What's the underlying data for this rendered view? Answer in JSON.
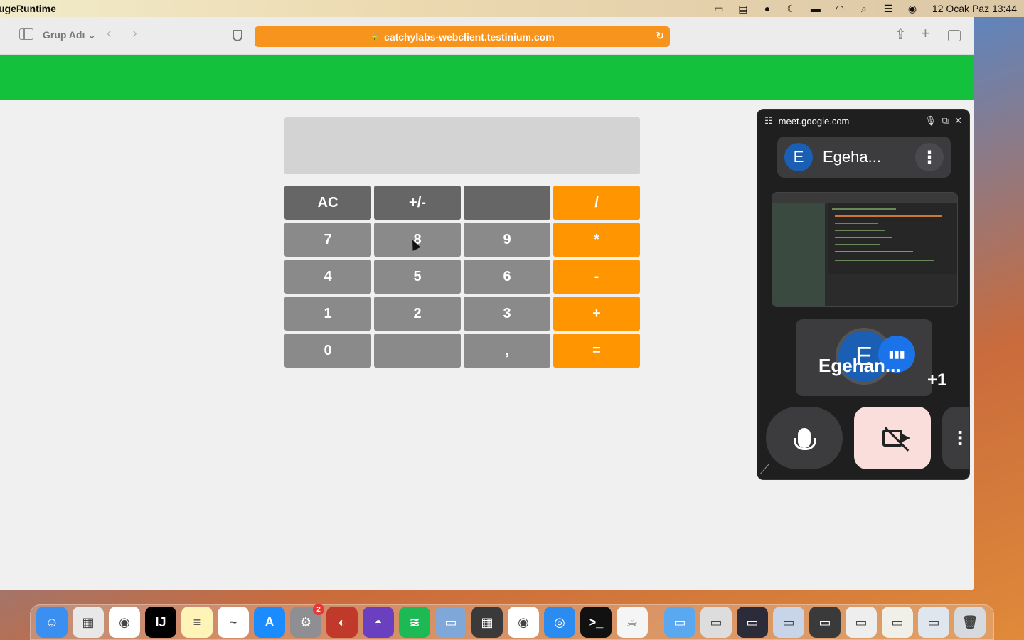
{
  "menubar": {
    "app_name": "ugeRuntime",
    "clock": "12 Ocak Paz  13:44",
    "icons": [
      "screen-mirror-icon",
      "vpn-icon",
      "globe-icon",
      "moon-icon",
      "battery-icon",
      "wifi-icon",
      "spotlight-icon",
      "control-center-icon",
      "siri-icon"
    ]
  },
  "browser": {
    "group_label": "Grup Adı ⌄",
    "url": "catchylabs-webclient.testinium.com",
    "url_bar_color": "#f7941d",
    "header_color": "#14c13c"
  },
  "calculator": {
    "display_value": "",
    "keys": [
      {
        "label": "AC",
        "kind": "dark"
      },
      {
        "label": "+/-",
        "kind": "dark"
      },
      {
        "label": "",
        "kind": "dark"
      },
      {
        "label": "/",
        "kind": "op"
      },
      {
        "label": "7",
        "kind": "num"
      },
      {
        "label": "8",
        "kind": "num"
      },
      {
        "label": "9",
        "kind": "num"
      },
      {
        "label": "*",
        "kind": "op"
      },
      {
        "label": "4",
        "kind": "num"
      },
      {
        "label": "5",
        "kind": "num"
      },
      {
        "label": "6",
        "kind": "num"
      },
      {
        "label": "-",
        "kind": "op"
      },
      {
        "label": "1",
        "kind": "num"
      },
      {
        "label": "2",
        "kind": "num"
      },
      {
        "label": "3",
        "kind": "num"
      },
      {
        "label": "+",
        "kind": "op"
      },
      {
        "label": "0",
        "kind": "num"
      },
      {
        "label": "",
        "kind": "num"
      },
      {
        "label": ",",
        "kind": "num"
      },
      {
        "label": "=",
        "kind": "op"
      }
    ],
    "operator_color": "#ff9500"
  },
  "meet": {
    "domain": "meet.google.com",
    "participant_initial": "E",
    "participant_name": "Egeha...",
    "tile_initial": "E",
    "tile_name": "Egehan...",
    "extra_count": "+1",
    "more_glyph": "⋮"
  },
  "dock": {
    "apps": [
      {
        "name": "finder-icon",
        "color": "#3b8ff0",
        "glyph": "☺"
      },
      {
        "name": "launchpad-icon",
        "color": "#e8e8e8",
        "glyph": "▦"
      },
      {
        "name": "chrome-icon",
        "color": "#ffffff",
        "glyph": "◉"
      },
      {
        "name": "intellij-icon",
        "color": "#000000",
        "glyph": "IJ"
      },
      {
        "name": "notes-icon",
        "color": "#fff4b8",
        "glyph": "≡"
      },
      {
        "name": "freeform-icon",
        "color": "#ffffff",
        "glyph": "~"
      },
      {
        "name": "app-store-icon",
        "color": "#1a8cff",
        "glyph": "A"
      },
      {
        "name": "system-settings-icon",
        "color": "#8e8e93",
        "glyph": "⚙",
        "badge": "2"
      },
      {
        "name": "pixel-icon",
        "color": "#c0392b",
        "glyph": "◐"
      },
      {
        "name": "firefox-icon",
        "color": "#6a3fc0",
        "glyph": "◓"
      },
      {
        "name": "spotify-icon",
        "color": "#1db954",
        "glyph": "≋"
      },
      {
        "name": "preview-icon",
        "color": "#7fa7d8",
        "glyph": "▭"
      },
      {
        "name": "calculator-icon",
        "color": "#3a3a3a",
        "glyph": "▦"
      },
      {
        "name": "chrome-icon-2",
        "color": "#ffffff",
        "glyph": "◉"
      },
      {
        "name": "safari-icon",
        "color": "#2a8cf0",
        "glyph": "◎"
      },
      {
        "name": "terminal-icon",
        "color": "#111111",
        "glyph": ">_"
      },
      {
        "name": "java-icon",
        "color": "#f5f5f5",
        "glyph": "☕"
      }
    ],
    "recents": [
      {
        "name": "folder-icon",
        "color": "#5aa9f0",
        "glyph": "▭"
      },
      {
        "name": "window-thumb-1-icon",
        "color": "#dddddd",
        "glyph": "▭"
      },
      {
        "name": "window-thumb-2-icon",
        "color": "#2b2b3a",
        "glyph": "▭"
      },
      {
        "name": "window-thumb-3-icon",
        "color": "#c8d4e8",
        "glyph": "▭"
      },
      {
        "name": "window-thumb-4-icon",
        "color": "#3a3a3a",
        "glyph": "▭"
      },
      {
        "name": "window-thumb-5-icon",
        "color": "#eeeeee",
        "glyph": "▭"
      },
      {
        "name": "window-thumb-6-icon",
        "color": "#f0f0e8",
        "glyph": "▭"
      },
      {
        "name": "window-thumb-7-icon",
        "color": "#e0e6ee",
        "glyph": "▭"
      },
      {
        "name": "trash-icon",
        "color": "#d6d9de",
        "glyph": "🗑"
      }
    ]
  }
}
